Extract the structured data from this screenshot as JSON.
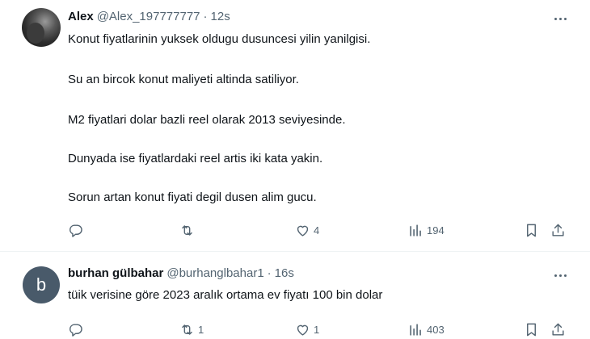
{
  "tweets": [
    {
      "avatar_letter": "",
      "name": "Alex",
      "handle": "@Alex_197777777",
      "separator": "·",
      "time": "12s",
      "lines": [
        "Konut fiyatlarinin yuksek oldugu dusuncesi yilin yanilgisi.",
        "Su an bircok konut maliyeti  altinda satiliyor.",
        "M2 fiyatlari dolar bazli  reel olarak  2013 seviyesinde.",
        "Dunyada ise fiyatlardaki reel artis iki kata yakin.",
        "Sorun artan konut fiyati  degil dusen alim gucu."
      ],
      "replies": "",
      "retweets": "",
      "likes": "4",
      "views": "194"
    },
    {
      "avatar_letter": "b",
      "name": "burhan gülbahar",
      "handle": "@burhanglbahar1",
      "separator": "·",
      "time": "16s",
      "lines": [
        "tüik verisine göre 2023 aralık ortama ev fiyatı 100 bin dolar"
      ],
      "replies": "",
      "retweets": "1",
      "likes": "1",
      "views": "403"
    }
  ],
  "icons": {
    "reply": "reply-icon",
    "retweet": "retweet-icon",
    "like": "heart-icon",
    "views": "views-icon",
    "bookmark": "bookmark-icon",
    "share": "share-icon",
    "more": "more-icon"
  },
  "colors": {
    "text": "#0f1419",
    "muted": "#536471",
    "divider": "#eff3f4",
    "avatar_b": "#495a6a"
  }
}
